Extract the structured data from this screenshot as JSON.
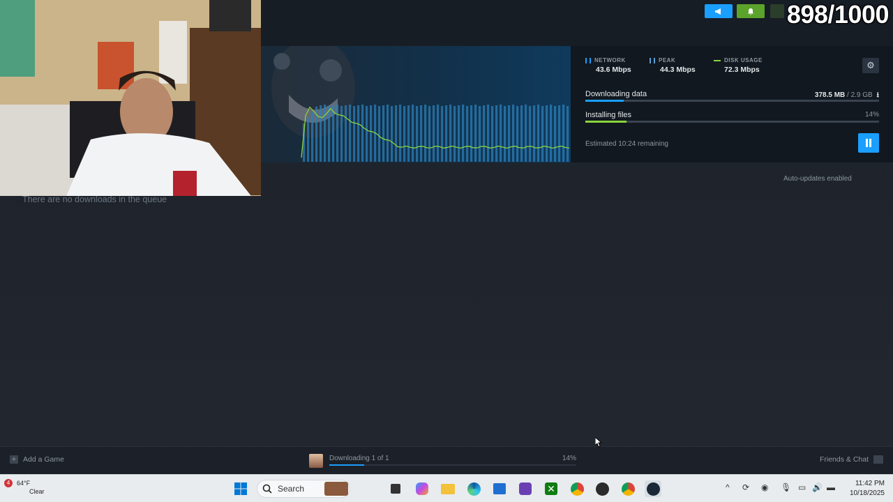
{
  "overlay": {
    "counter": "898/1000"
  },
  "stats": [
    {
      "label": "NETWORK",
      "value": "43.6 Mbps",
      "color": "#1a9fff"
    },
    {
      "label": "PEAK",
      "value": "44.3 Mbps",
      "color": "#5c9fd6"
    },
    {
      "label": "DISK USAGE",
      "value": "72.3 Mbps",
      "color": "#8bd43e"
    }
  ],
  "download": {
    "downloading_label": "Downloading data",
    "downloaded": "378.5 MB",
    "total": "/ 2.9 GB",
    "downloading_progress": 0.13,
    "installing_label": "Installing files",
    "installing_percent": "14%",
    "installing_progress": 0.14,
    "eta": "Estimated 10:24 remaining"
  },
  "queue": {
    "auto_updates": "Auto-updates enabled",
    "empty_message": "There are no downloads in the queue"
  },
  "footer": {
    "add_game": "Add a Game",
    "downloading_status": "Downloading 1 of 1",
    "downloading_percent": "14%",
    "downloading_progress": 0.14,
    "friends_chat": "Friends & Chat"
  },
  "taskbar": {
    "temperature": "64°F",
    "weather_condition": "Clear",
    "weather_badge": "4",
    "search_placeholder": "Search",
    "time": "11:42 PM",
    "date": "10/18/2025"
  },
  "colors": {
    "accent": "#1a9fff",
    "disk_green": "#8bd43e",
    "panel_bg": "#111820"
  }
}
